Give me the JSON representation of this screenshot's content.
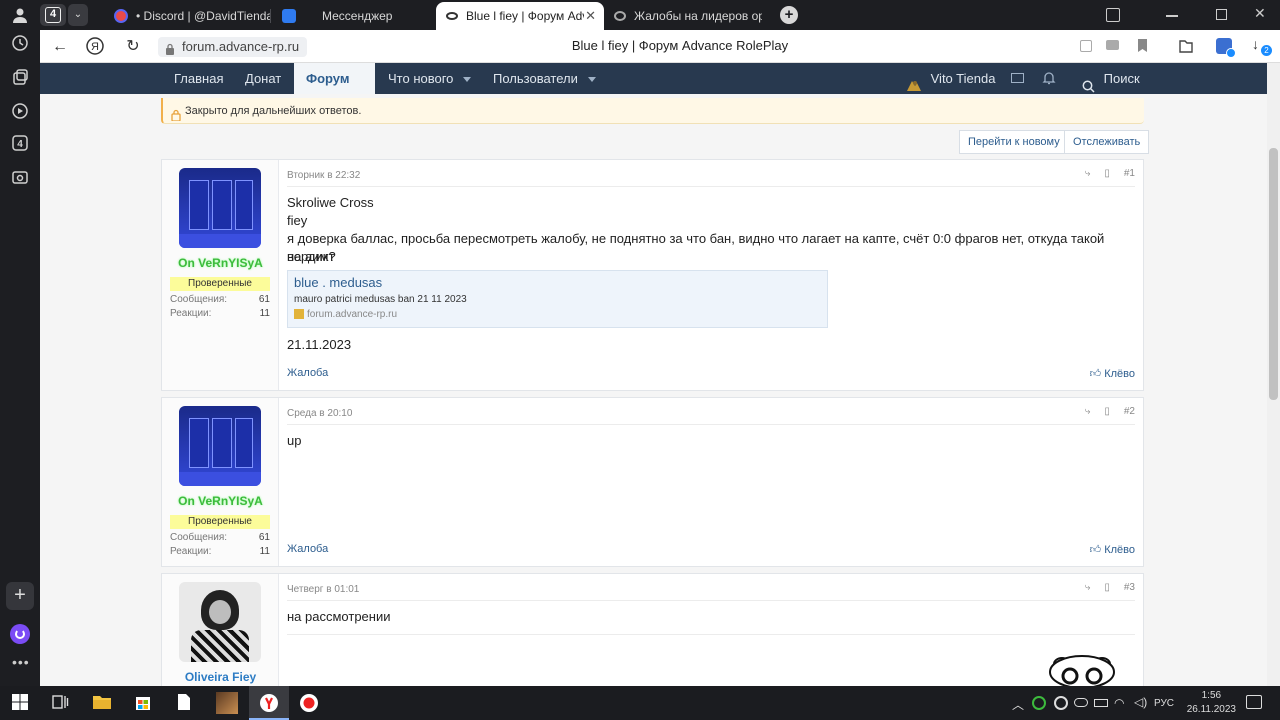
{
  "browser": {
    "tab_counter": "4",
    "tabs": [
      {
        "label": "• Discord | @DavidTienda"
      },
      {
        "label": "Мессенджер"
      },
      {
        "label": "Blue l fiey | Форум Advance RolePlay"
      },
      {
        "label": "Жалобы на лидеров организаций"
      }
    ],
    "url": "forum.advance-rp.ru",
    "page_title": "Blue l fiey | Форум Advance RolePlay",
    "download_badge": "2"
  },
  "forum_nav": {
    "items": [
      "Главная",
      "Донат",
      "Форум",
      "Что нового",
      "Пользователи"
    ],
    "username": "Vito Tienda",
    "search_label": "Поиск"
  },
  "thread": {
    "closed_notice": "Закрыто для дальнейших ответов.",
    "goto_new_label": "Перейти к новому",
    "watch_label": "Отслеживать"
  },
  "posts": [
    {
      "author": "On VeRnYISyA",
      "badge": "Проверенные",
      "messages_label": "Сообщения:",
      "messages": "61",
      "reactions_label": "Реакции:",
      "reactions": "11",
      "date": "Вторник в 22:32",
      "number": "#1",
      "lines": [
        "Skroliwe Cross",
        "fiey",
        "я доверка баллас, просьба пересмотреть жалобу, не поднятно за что бан, видно что лагает на капте, счёт 0:0 фрагов нет, откуда такой вердикт",
        "на аим?"
      ],
      "embed": {
        "title": "blue . medusas",
        "desc": "mauro patrici medusas ban 21 11 2023",
        "source": "forum.advance-rp.ru"
      },
      "after_text": "21.11.2023",
      "report": "Жалоба",
      "like": "Клёво"
    },
    {
      "author": "On VeRnYISyA",
      "badge": "Проверенные",
      "messages_label": "Сообщения:",
      "messages": "61",
      "reactions_label": "Реакции:",
      "reactions": "11",
      "date": "Среда в 20:10",
      "number": "#2",
      "text": "up",
      "report": "Жалоба",
      "like": "Клёво"
    },
    {
      "author": "Oliveira Fiey",
      "date": "Четверг в 01:01",
      "number": "#3",
      "text": "на рассмотрении"
    }
  ],
  "taskbar": {
    "lang": "РУС",
    "time": "1:56",
    "date": "26.11.2023"
  },
  "colors": {
    "nav_bg": "#28394f",
    "link": "#2d5d8e",
    "author_green": "#3dbb3d",
    "author2_blue": "#2d7cc4",
    "badge_yellow": "#fcfc9a"
  }
}
